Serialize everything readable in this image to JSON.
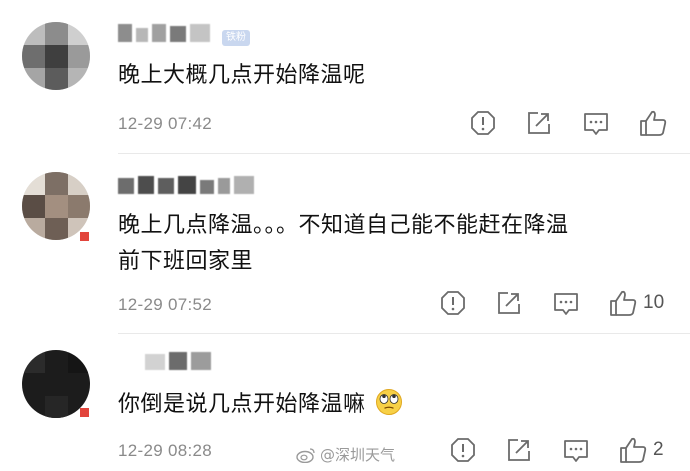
{
  "comments": [
    {
      "user": {
        "name": "",
        "badge": "铁粉"
      },
      "text_lines": [
        "晚上大概几点开始降温呢"
      ],
      "time": "12-29 07:42",
      "like_count": ""
    },
    {
      "user": {
        "name": ""
      },
      "text_lines": [
        "晚上几点降温。。。不知道自己能不能赶在降温",
        "前下班回家里"
      ],
      "time": "12-29 07:52",
      "like_count": "10"
    },
    {
      "user": {
        "name": ""
      },
      "text_lines": [
        "你倒是说几点开始降温嘛"
      ],
      "emoji": "eye-roll-emoji",
      "time": "12-29 08:28",
      "like_count": "2"
    }
  ],
  "icons": [
    "report-icon",
    "share-icon",
    "comment-icon",
    "like-icon"
  ],
  "watermark": {
    "text": "@深圳天气",
    "icon": "weibo-logo-icon"
  },
  "colors": {
    "text": "#111111",
    "meta": "#8a8a8a",
    "divider": "#e9e9e9",
    "icon": "#6b6b6b"
  }
}
